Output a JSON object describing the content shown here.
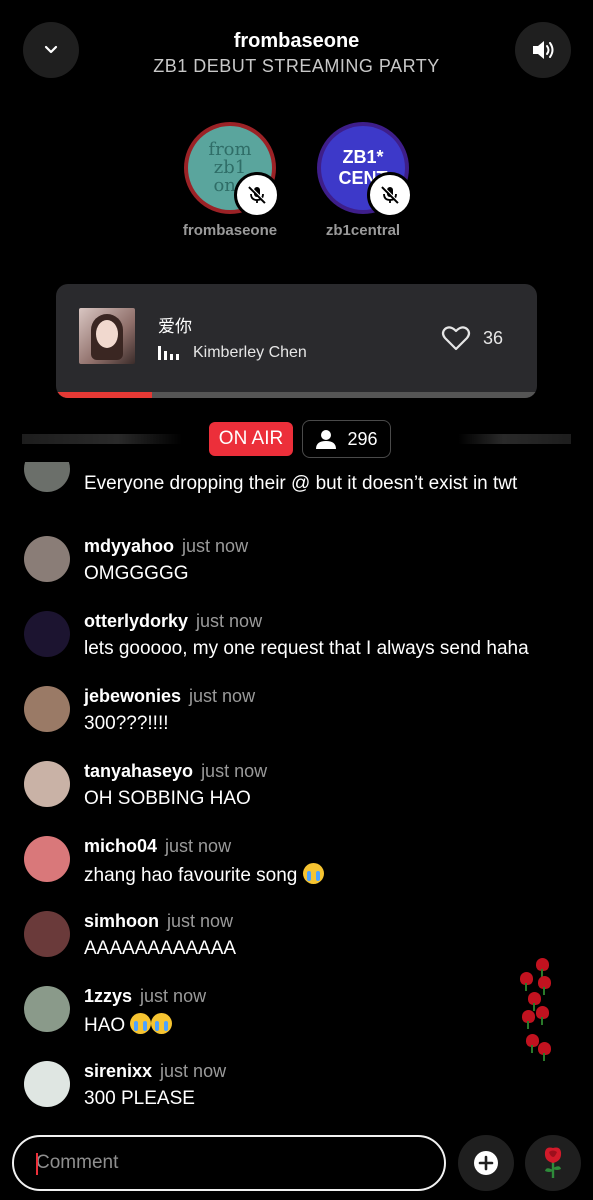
{
  "header": {
    "title": "frombaseone",
    "subtitle": "ZB1 DEBUT STREAMING PARTY"
  },
  "hosts": [
    {
      "name": "frombaseone",
      "avatar_text": "from\nzb1\none",
      "ring_color": "#9b2226"
    },
    {
      "name": "zb1central",
      "avatar_text": "ZB1* CENT",
      "ring_color": "#3e1e8a"
    }
  ],
  "now_playing": {
    "title": "爱你",
    "artist": "Kimberley Chen",
    "likes": "36",
    "progress": 0.2
  },
  "status": {
    "on_air": "ON AIR",
    "listeners": "296"
  },
  "chat": [
    {
      "user": "",
      "time": "",
      "text": "Everyone dropping their @ but it doesn’t exist in twt",
      "avatar_color": "#6b6f6a"
    },
    {
      "user": "mdyyahoo",
      "time": "just now",
      "text": "OMGGGGG",
      "avatar_color": "#8a7d77"
    },
    {
      "user": "otterlydorky",
      "time": "just now",
      "text": "lets gooooo, my one request that I always send haha",
      "avatar_color": "#1c1430"
    },
    {
      "user": "jebewonies",
      "time": "just now",
      "text": "300???!!!!",
      "avatar_color": "#9a7a66"
    },
    {
      "user": "tanyahaseyo",
      "time": "just now",
      "text": "OH SOBBING HAO",
      "avatar_color": "#c9b2a6"
    },
    {
      "user": "micho04",
      "time": "just now",
      "text": "zhang hao favourite song",
      "avatar_color": "#d9787a"
    },
    {
      "user": "simhoon",
      "time": "just now",
      "text": "AAAAAAAAAAAA",
      "avatar_color": "#6a3a3a"
    },
    {
      "user": "1zzys",
      "time": "just now",
      "text": "HAO",
      "avatar_color": "#8a9a8a"
    },
    {
      "user": "sirenixx",
      "time": "just now",
      "text": "300 PLEASE",
      "avatar_color": "#dfe6e2"
    }
  ],
  "composer": {
    "placeholder": "Comment"
  },
  "icons": {
    "collapse": "chevron-down-icon",
    "volume": "volume-icon",
    "mute": "mic-off-icon",
    "like": "heart-icon",
    "listeners": "person-icon",
    "add": "plus-icon",
    "gift": "rose-icon"
  },
  "colors": {
    "accent": "#ec2f3a",
    "background": "#000000",
    "card": "#2a2a2d"
  }
}
